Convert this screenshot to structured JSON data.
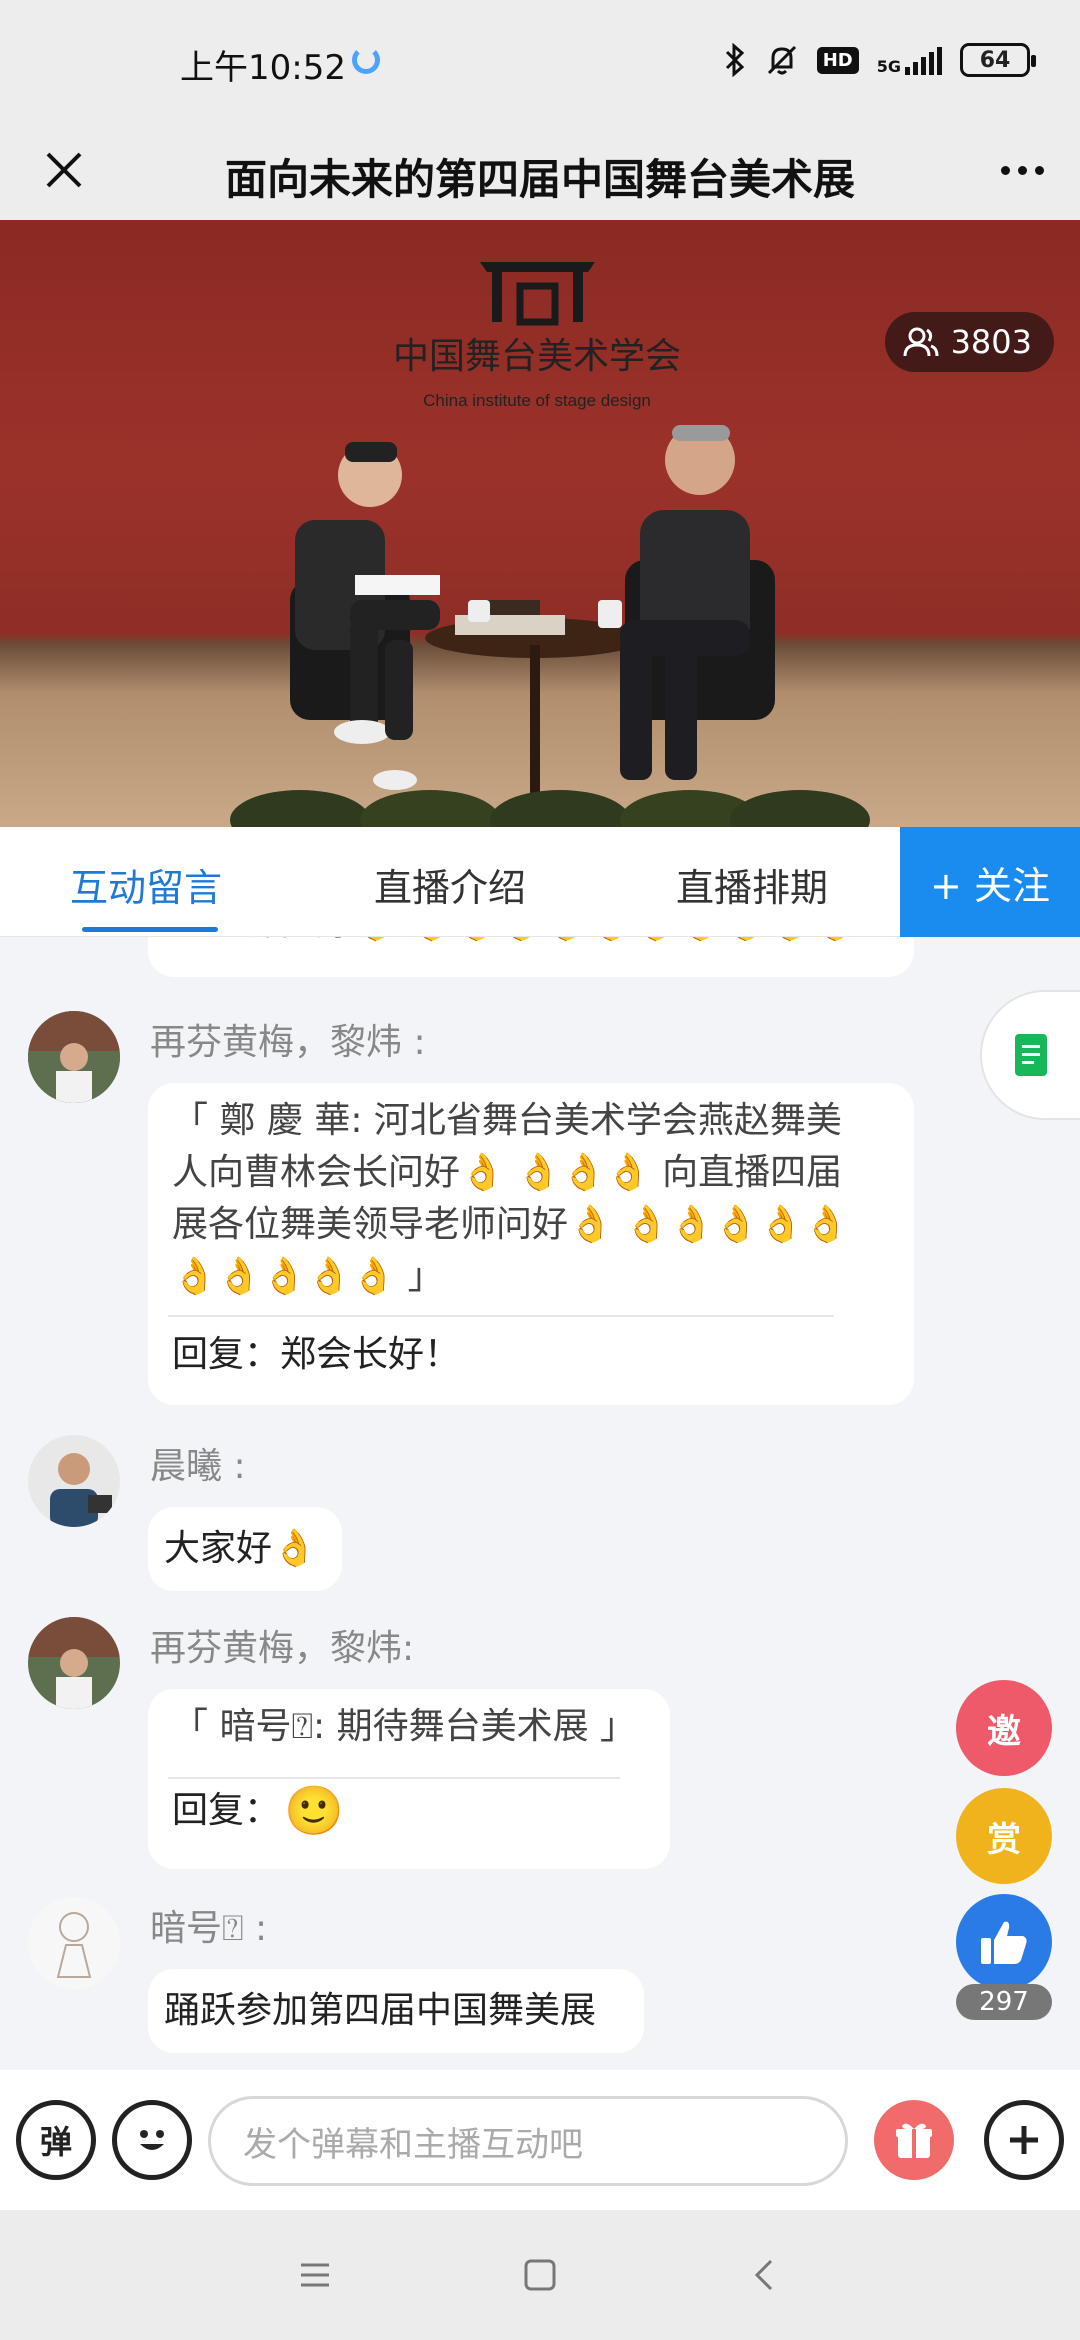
{
  "status_bar": {
    "time": "上午10:52",
    "network": "5G",
    "hd": "HD",
    "battery": "64"
  },
  "nav": {
    "title": "面向未来的第四届中国舞台美术展"
  },
  "video": {
    "viewer_count": "3803",
    "logo_text_cn": "中国舞台美术学会",
    "logo_text_en": "China institute of stage design"
  },
  "tabs": {
    "items": [
      "互动留言",
      "直播介绍",
      "直播排期"
    ],
    "follow": "+ 关注"
  },
  "comments": {
    "partial_top": "导老师问好👌 👌👌👌👌👌👌👌👌👌👌",
    "c1": {
      "user": "再芬黄梅，黎炜 :",
      "quote_line1": "「 鄭 慶 華: 河北省舞台美术学会燕赵舞美",
      "quote_line2": "人向曹林会长问好👌 👌👌👌 向直播四届",
      "quote_line3": "展各位舞美领导老师问好👌 👌👌👌👌👌",
      "quote_line4": "👌👌👌👌👌 」",
      "reply": "回复：郑会长好！"
    },
    "c2": {
      "user": "晨曦 :",
      "text": "大家好👌"
    },
    "c3": {
      "user": "再芬黄梅，黎炜:",
      "quote": "「 暗号⍰: 期待舞台美术展 」",
      "reply_label": "回复：",
      "reply_emoji": "🙂"
    },
    "c4": {
      "user": "暗号⍰ :",
      "text": "踊跃参加第四届中国舞美展"
    }
  },
  "floating": {
    "invite": "邀",
    "reward": "赏",
    "like_count": "297"
  },
  "input_bar": {
    "danmu": "弹",
    "placeholder": "发个弹幕和主播互动吧"
  },
  "colors": {
    "accent": "#1a8cf0",
    "tab_active": "#1f7ad6",
    "invite": "#ee5a6a",
    "reward": "#f1b31c",
    "like": "#2a7be6"
  }
}
